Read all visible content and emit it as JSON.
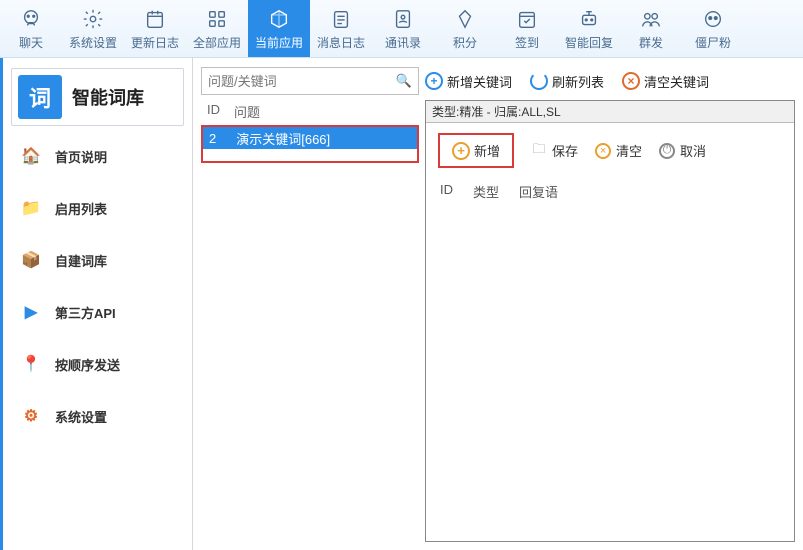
{
  "topnav": [
    {
      "label": "聊天"
    },
    {
      "label": "系统设置"
    },
    {
      "label": "更新日志"
    },
    {
      "label": "全部应用"
    },
    {
      "label": "当前应用"
    },
    {
      "label": "消息日志"
    },
    {
      "label": "通讯录"
    },
    {
      "label": "积分"
    },
    {
      "label": "签到"
    },
    {
      "label": "智能回复"
    },
    {
      "label": "群发"
    },
    {
      "label": "僵尸粉"
    }
  ],
  "sidebar": {
    "badge": "词",
    "title": "智能词库",
    "items": [
      {
        "label": "首页说明",
        "icon": "🏠",
        "color": "#e8a02b"
      },
      {
        "label": "启用列表",
        "icon": "📁",
        "color": "#2bb36a"
      },
      {
        "label": "自建词库",
        "icon": "📦",
        "color": "#e8602b"
      },
      {
        "label": "第三方API",
        "icon": "▶",
        "color": "#2b8ce8"
      },
      {
        "label": "按顺序发送",
        "icon": "📍",
        "color": "#2bb36a"
      },
      {
        "label": "系统设置",
        "icon": "⚙",
        "color": "#e86a2b"
      }
    ]
  },
  "search": {
    "placeholder": "问题/关键词"
  },
  "actions": {
    "add_keyword": "新增关键词",
    "refresh": "刷新列表",
    "clear_keyword": "清空关键词"
  },
  "list": {
    "headers": {
      "id": "ID",
      "question": "问题"
    },
    "rows": [
      {
        "id": "2",
        "question": "演示关键词[666]"
      }
    ]
  },
  "right": {
    "header": "类型:精准 - 归属:ALL,SL",
    "actions": {
      "add": "新增",
      "save": "保存",
      "clear": "清空",
      "cancel": "取消"
    },
    "reply_headers": {
      "id": "ID",
      "type": "类型",
      "reply": "回复语"
    }
  }
}
